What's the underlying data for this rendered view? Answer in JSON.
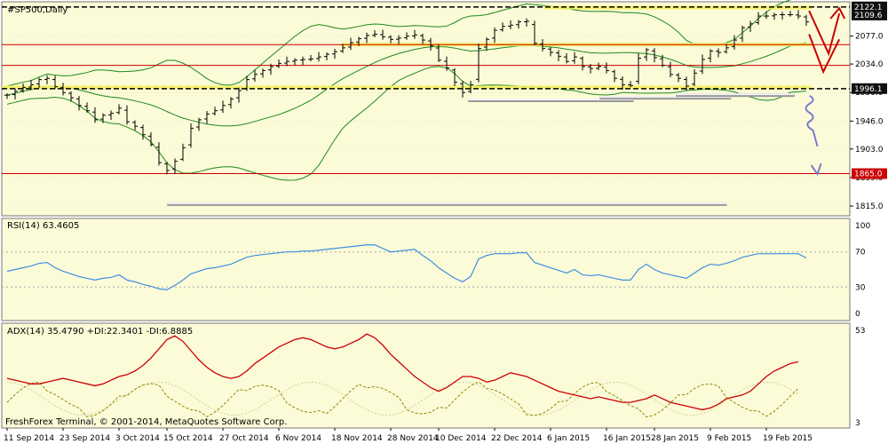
{
  "chart_data": {
    "type": "candlestick",
    "symbol_label": "#SP500,Daily",
    "copyright": "FreshForex Terminal, © 2001-2014, MetaQuotes Software Corp.",
    "colors": {
      "background": "#fbfbd8",
      "bar": "#000000",
      "bollinger": "#1c8a1c",
      "resistance": "#cc0000",
      "support_white": "#d8d8d8",
      "rsi_line": "#3f8fe0",
      "adx_line": "#cc0000",
      "di_plus": "#8a8a00",
      "di_minus": "#cfcf9a",
      "arrow_blue": "#7a7ad0",
      "arrow_red": "#cc0000",
      "price_tag_black": "#101010",
      "price_tag_red": "#cc0000",
      "yellow_band": "#f5f060"
    },
    "main_panel": {
      "y_axis": {
        "min": 1800,
        "max": 2130,
        "ticks": [
          2077.0,
          2034.0,
          1990.0,
          1946.0,
          1903.0,
          1859.0,
          1815.0
        ],
        "tick_labels": [
          "2077.0",
          "2034.0",
          "1990.0",
          "1946.0",
          "1903.0",
          "1859.0",
          "1815.0"
        ]
      },
      "price_tags": [
        {
          "value": 2122.1,
          "label": "2122.1",
          "style": "black"
        },
        {
          "value": 2109.6,
          "label": "2109.6",
          "style": "black"
        },
        {
          "value": 1996.1,
          "label": "1996.1",
          "style": "black"
        },
        {
          "value": 1865.0,
          "label": "1865.0",
          "style": "red"
        }
      ],
      "horizontal_lines": [
        {
          "value": 2064,
          "color": "red"
        },
        {
          "value": 2032,
          "color": "red"
        },
        {
          "value": 1865,
          "color": "red"
        },
        {
          "value": 2122,
          "color": "black-dashed"
        },
        {
          "value": 1996,
          "color": "black-dashed"
        }
      ],
      "yellow_bands": [
        {
          "value": 2121,
          "x_from": 0.64,
          "x_to": 0.955
        },
        {
          "value": 2064,
          "x_from": 0.4,
          "x_to": 0.955
        },
        {
          "value": 1998,
          "x_from": 0.0,
          "x_to": 0.955
        }
      ],
      "support_lines": [
        {
          "value": 1978,
          "x_from": 0.55,
          "x_to": 0.745
        },
        {
          "value": 1982,
          "x_from": 0.705,
          "x_to": 0.86
        },
        {
          "value": 1986,
          "x_from": 0.795,
          "x_to": 0.935
        },
        {
          "value": 1818,
          "x_from": 0.195,
          "x_to": 0.855
        }
      ],
      "closes": [
        1986,
        1992,
        1998,
        2002,
        2010,
        2012,
        1999,
        1990,
        1982,
        1970,
        1962,
        1948,
        1955,
        1958,
        1966,
        1945,
        1938,
        1925,
        1910,
        1882,
        1870,
        1884,
        1905,
        1935,
        1948,
        1957,
        1962,
        1970,
        1980,
        1993,
        2010,
        2018,
        2024,
        2030,
        2035,
        2038,
        2040,
        2041,
        2042,
        2045,
        2049,
        2053,
        2059,
        2067,
        2073,
        2078,
        2080,
        2076,
        2072,
        2074,
        2077,
        2079,
        2071,
        2062,
        2040,
        2028,
        2006,
        1990,
        2002,
        2058,
        2072,
        2086,
        2092,
        2094,
        2099,
        2100,
        2066,
        2058,
        2052,
        2046,
        2038,
        2045,
        2030,
        2027,
        2030,
        2024,
        2012,
        2002,
        2001,
        2043,
        2056,
        2044,
        2032,
        2018,
        2012,
        2000,
        2020,
        2041,
        2054,
        2052,
        2059,
        2071,
        2090,
        2096,
        2108,
        2108,
        2110,
        2110,
        2110,
        2108,
        2099
      ]
    },
    "x_axis": {
      "labels": [
        "11 Sep 2014",
        "23 Sep 2014",
        "3 Oct 2014",
        "15 Oct 2014",
        "27 Oct 2014",
        "6 Nov 2014",
        "18 Nov 2014",
        "28 Nov 2014",
        "10 Dec 2014",
        "22 Dec 2014",
        "6 Jan 2015",
        "16 Jan 2015",
        "28 Jan 2015",
        "9 Feb 2015",
        "19 Feb 2015"
      ]
    },
    "rsi_panel": {
      "label": "RSI(14) 63.4605",
      "y_axis": {
        "min": 0,
        "max": 100,
        "ticks": [
          100,
          70,
          30,
          0
        ],
        "tick_labels": [
          "100",
          "70",
          "30",
          "0"
        ]
      },
      "levels": [
        70,
        30
      ],
      "values": [
        48,
        50,
        52,
        54,
        57,
        58,
        52,
        48,
        45,
        42,
        40,
        38,
        40,
        41,
        44,
        38,
        36,
        33,
        31,
        28,
        27,
        32,
        38,
        45,
        48,
        51,
        52,
        54,
        56,
        60,
        64,
        66,
        67,
        68,
        69,
        70,
        70,
        71,
        71,
        72,
        73,
        74,
        75,
        76,
        77,
        78,
        78,
        74,
        70,
        71,
        72,
        73,
        66,
        60,
        52,
        46,
        40,
        36,
        42,
        62,
        66,
        68,
        68,
        68,
        69,
        69,
        58,
        55,
        52,
        49,
        46,
        50,
        44,
        43,
        44,
        42,
        40,
        38,
        38,
        50,
        56,
        50,
        46,
        44,
        42,
        40,
        46,
        52,
        56,
        55,
        57,
        60,
        64,
        66,
        68,
        68,
        68,
        68,
        68,
        68,
        63
      ]
    },
    "adx_panel": {
      "label": "ADX(14) 35.4790 +DI:22.3401 -DI:6.8885",
      "y_axis": {
        "min": 3,
        "max": 53,
        "ticks": [
          53,
          3
        ],
        "tick_labels": [
          "53",
          "3"
        ]
      },
      "adx": [
        27,
        26,
        25,
        24,
        24,
        25,
        26,
        27,
        26,
        25,
        24,
        23,
        24,
        26,
        28,
        29,
        31,
        34,
        38,
        43,
        48,
        50,
        47,
        42,
        37,
        33,
        30,
        28,
        27,
        28,
        31,
        35,
        38,
        41,
        44,
        46,
        48,
        49,
        48,
        46,
        44,
        43,
        44,
        46,
        48,
        51,
        49,
        45,
        40,
        36,
        32,
        28,
        25,
        22,
        20,
        22,
        25,
        28,
        28,
        27,
        25,
        26,
        28,
        30,
        29,
        28,
        26,
        24,
        22,
        20,
        19,
        18,
        17,
        16,
        17,
        16,
        15,
        14,
        14,
        15,
        16,
        18,
        16,
        14,
        13,
        12,
        11,
        10,
        11,
        13,
        16,
        17,
        18,
        20,
        24,
        28,
        31,
        33,
        35,
        36
      ]
    }
  }
}
